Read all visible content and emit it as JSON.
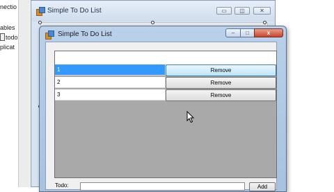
{
  "ide": {
    "left_lines": [
      "nectio",
      "ables",
      "todo",
      "plicat"
    ]
  },
  "designer_window": {
    "title": "Simple To Do List",
    "controls": {
      "minimize": "▭",
      "maximize": "◫",
      "close": "✕"
    }
  },
  "app_window": {
    "title": "Simple To Do List",
    "controls": {
      "minimize": "–",
      "maximize": "□",
      "close": "x"
    },
    "rows": [
      {
        "value": "1",
        "button": "Remove"
      },
      {
        "value": "2",
        "button": "Remove"
      },
      {
        "value": "3",
        "button": "Remove"
      }
    ],
    "bottom": {
      "label": "Todo:",
      "add_label": "Add"
    }
  }
}
